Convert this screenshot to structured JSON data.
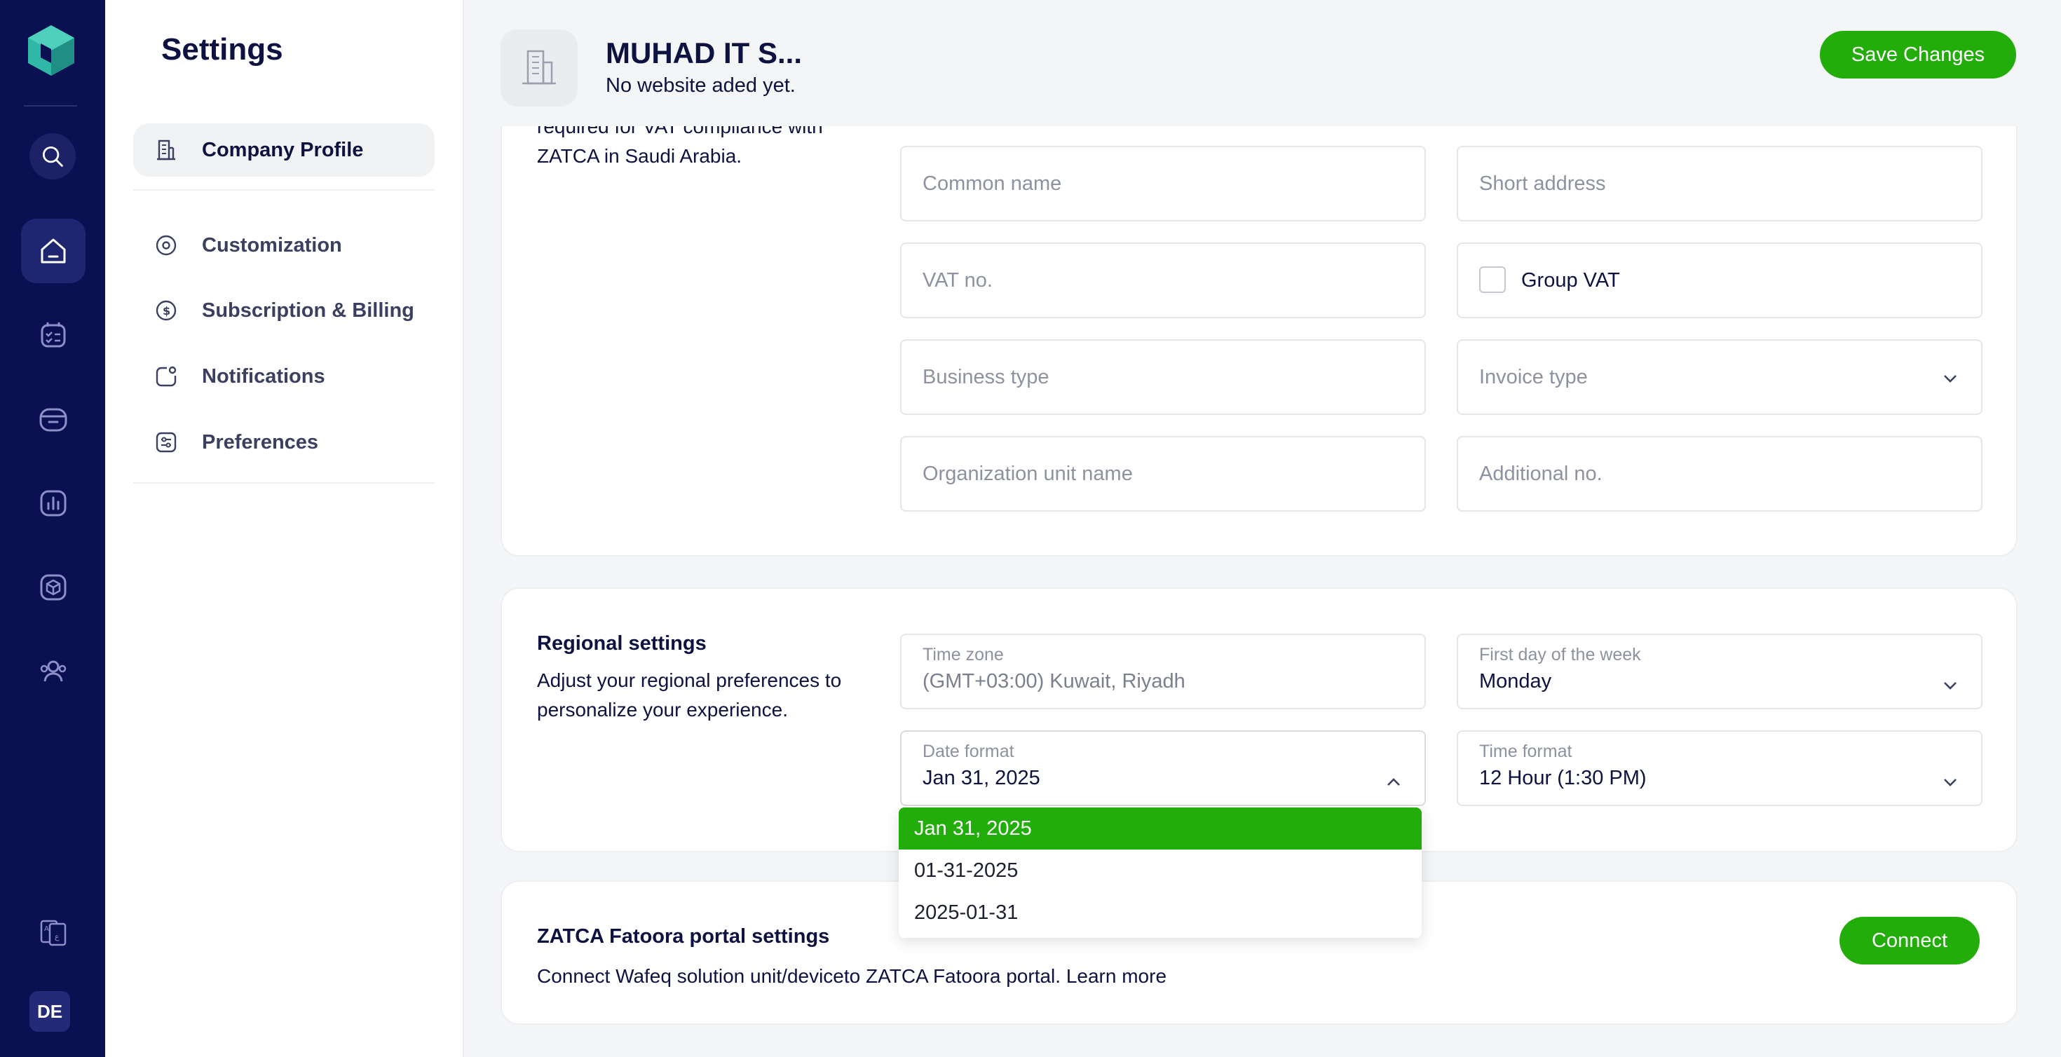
{
  "rail": {
    "items": [
      "logo-icon",
      "search-icon",
      "home-icon",
      "tasks-icon",
      "sales-icon",
      "reports-icon",
      "inventory-icon",
      "contacts-icon",
      "language-icon"
    ],
    "user_initials": "DE"
  },
  "settings_nav": {
    "title": "Settings",
    "items": [
      {
        "label": "Company Profile",
        "icon": "building-icon",
        "active": true
      },
      {
        "label": "Customization",
        "icon": "target-icon"
      },
      {
        "label": "Subscription & Billing",
        "icon": "dollar-icon"
      },
      {
        "label": "Notifications",
        "icon": "bell-icon"
      },
      {
        "label": "Preferences",
        "icon": "sliders-icon"
      }
    ]
  },
  "header": {
    "company_name": "MUHAD IT S...",
    "website": "No website aded yet.",
    "save_label": "Save Changes"
  },
  "zatca_card": {
    "desc_partial_top": "required for VAT compliance with",
    "desc_partial_bottom": "ZATCA in Saudi Arabia.",
    "fields": {
      "common_name": "Common name",
      "short_address": "Short address",
      "vat_no": "VAT no.",
      "group_vat": "Group VAT",
      "business_type": "Business type",
      "invoice_type": "Invoice type",
      "org_unit": "Organization unit name",
      "additional_no": "Additional no."
    }
  },
  "regional": {
    "title": "Regional settings",
    "desc": "Adjust your regional preferences to personalize your experience.",
    "time_zone": {
      "label": "Time zone",
      "value": "(GMT+03:00) Kuwait, Riyadh"
    },
    "first_day": {
      "label": "First day of the week",
      "value": "Monday"
    },
    "date_format": {
      "label": "Date format",
      "value": "Jan 31, 2025",
      "options": [
        "Jan 31, 2025",
        "01-31-2025",
        "2025-01-31"
      ]
    },
    "time_format": {
      "label": "Time format",
      "value": "12 Hour (1:30 PM)"
    }
  },
  "portal": {
    "title": "ZATCA Fatoora portal settings",
    "desc": "Connect Wafeq solution unit/deviceto ZATCA Fatoora portal.",
    "learn_more": "Learn more",
    "connect_label": "Connect"
  },
  "colors": {
    "rail": "#0b1052",
    "accent": "#22ad0a",
    "text": "#0d1240"
  }
}
